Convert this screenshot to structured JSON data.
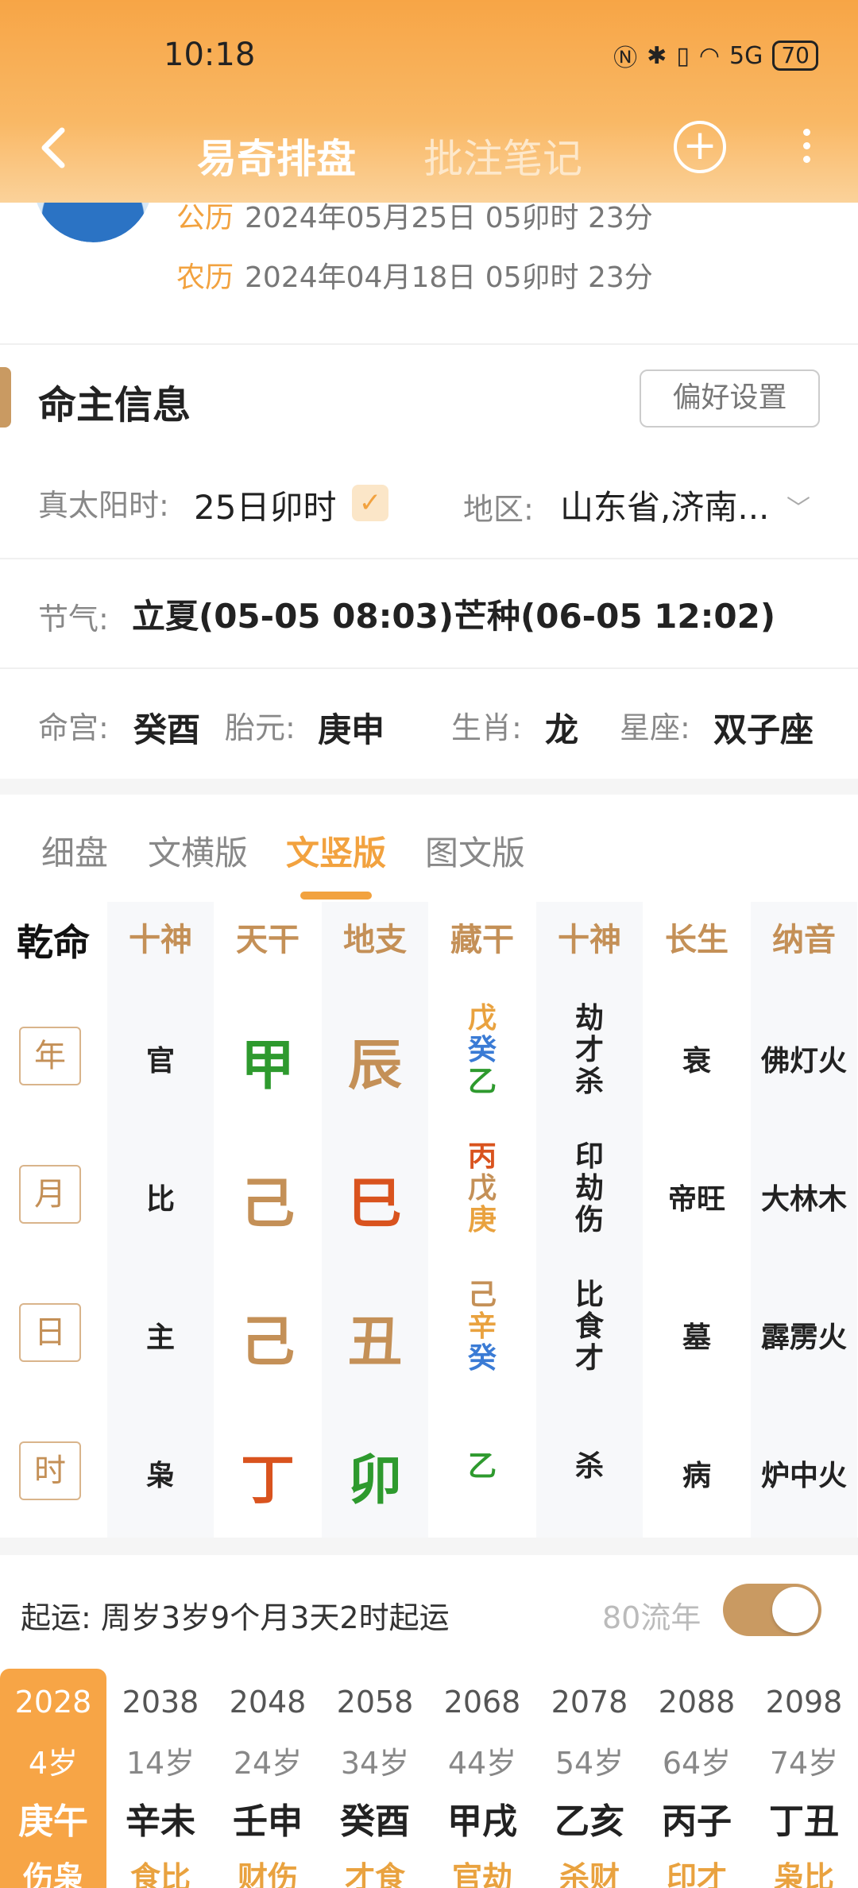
{
  "status": {
    "time": "10:18",
    "battery": "70",
    "signal": "5G"
  },
  "nav": {
    "title": "易奇排盘",
    "tab2": "批注笔记"
  },
  "dates": {
    "solar_label": "公历",
    "solar_value": "2024年05月25日 05卯时 23分",
    "lunar_label": "农历",
    "lunar_value": "2024年04月18日 05卯时 23分"
  },
  "owner": {
    "title": "命主信息",
    "pref_button": "偏好设置",
    "solar_time_label": "真太阳时:",
    "solar_time_value": "25日卯时",
    "region_label": "地区:",
    "region_value": "山东省,济南...",
    "jieqi_label": "节气:",
    "jieqi_value": "立夏(05-05 08:03)芒种(06-05 12:02)",
    "minggong_label": "命宫:",
    "minggong_value": "癸酉",
    "taiyuan_label": "胎元:",
    "taiyuan_value": "庚申",
    "shengxiao_label": "生肖:",
    "shengxiao_value": "龙",
    "xingzuo_label": "星座:",
    "xingzuo_value": "双子座"
  },
  "pan_tabs": [
    "细盘",
    "文横版",
    "文竖版",
    "图文版"
  ],
  "grid": {
    "corner": "乾命",
    "headers": [
      "十神",
      "天干",
      "地支",
      "藏干",
      "十神",
      "长生",
      "纳音"
    ],
    "rows": [
      {
        "pillar": "年",
        "shishen": "官",
        "gan": "甲",
        "zhi": "辰",
        "canggan": [
          "戊",
          "癸",
          "乙"
        ],
        "shishen2": [
          "劫",
          "才",
          "杀"
        ],
        "changsheng": "衰",
        "nayin": "佛灯火"
      },
      {
        "pillar": "月",
        "shishen": "比",
        "gan": "己",
        "zhi": "巳",
        "canggan": [
          "丙",
          "戊",
          "庚"
        ],
        "shishen2": [
          "印",
          "劫",
          "伤"
        ],
        "changsheng": "帝旺",
        "nayin": "大林木"
      },
      {
        "pillar": "日",
        "shishen": "主",
        "gan": "己",
        "zhi": "丑",
        "canggan": [
          "己",
          "辛",
          "癸"
        ],
        "shishen2": [
          "比",
          "食",
          "才"
        ],
        "changsheng": "墓",
        "nayin": "霹雳火"
      },
      {
        "pillar": "时",
        "shishen": "枭",
        "gan": "丁",
        "zhi": "卯",
        "canggan": [
          "乙"
        ],
        "shishen2": [
          "杀"
        ],
        "changsheng": "病",
        "nayin": "炉中火"
      }
    ]
  },
  "qiyun": {
    "label": "起运:  周岁3岁9个月3天2时起运",
    "liunian": "80流年",
    "toggle_on": true
  },
  "dayun": [
    {
      "year": "2028",
      "age": "4岁",
      "gz": "庚午",
      "tag": "伤枭"
    },
    {
      "year": "2038",
      "age": "14岁",
      "gz": "辛未",
      "tag": "食比"
    },
    {
      "year": "2048",
      "age": "24岁",
      "gz": "壬申",
      "tag": "财伤"
    },
    {
      "year": "2058",
      "age": "34岁",
      "gz": "癸酉",
      "tag": "才食"
    },
    {
      "year": "2068",
      "age": "44岁",
      "gz": "甲戌",
      "tag": "官劫"
    },
    {
      "year": "2078",
      "age": "54岁",
      "gz": "乙亥",
      "tag": "杀财"
    },
    {
      "year": "2088",
      "age": "64岁",
      "gz": "丙子",
      "tag": "印才"
    },
    {
      "year": "2098",
      "age": "74岁",
      "gz": "丁丑",
      "tag": "枭比"
    }
  ]
}
